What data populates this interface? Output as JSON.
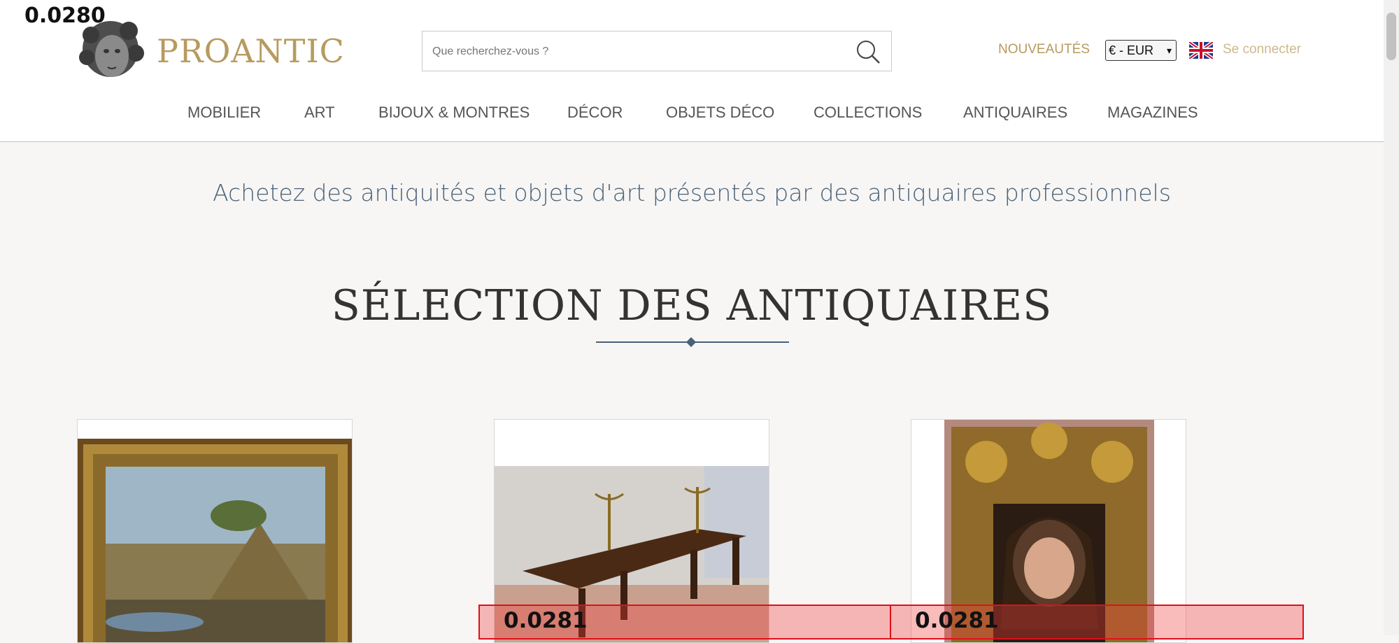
{
  "header": {
    "brand": "PROANTIC",
    "search_placeholder": "Que recherchez-vous ?",
    "nouveautes": "NOUVEAUTÉS",
    "currency": "€ - EUR",
    "login": "Se connecter"
  },
  "nav": {
    "items": [
      "MOBILIER",
      "ART",
      "BIJOUX & MONTRES",
      "DÉCOR",
      "OBJETS DÉCO",
      "COLLECTIONS",
      "ANTIQUAIRES",
      "MAGAZINES"
    ]
  },
  "main": {
    "tagline": "Achetez des antiquités et objets d'art présentés par des antiquaires professionnels",
    "section_title": "SÉLECTION DES ANTIQUAIRES"
  },
  "overlay": {
    "top_left_score": "0.0280",
    "scores": [
      "0.0281",
      "0.0281"
    ]
  },
  "colors": {
    "accent": "#b89a5e",
    "heading": "#4a6178",
    "highlight": "#e0101a"
  }
}
